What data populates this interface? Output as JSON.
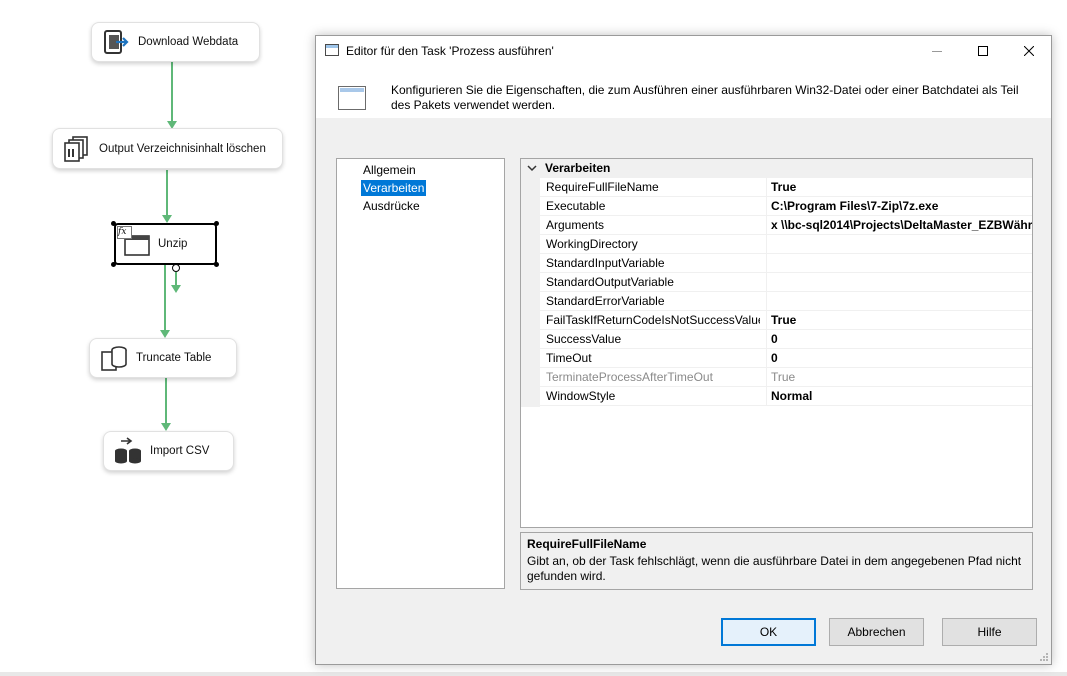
{
  "canvas": {
    "tasks": [
      {
        "label": "Download Webdata",
        "icon": "download-icon"
      },
      {
        "label": "Output Verzeichnisinhalt löschen",
        "icon": "file-system-icon"
      },
      {
        "label": "Unzip",
        "icon": "execute-process-icon"
      },
      {
        "label": "Truncate Table",
        "icon": "sql-task-icon"
      },
      {
        "label": "Import CSV",
        "icon": "data-flow-icon"
      }
    ],
    "colors": {
      "connector": "#5fb878"
    }
  },
  "dialog": {
    "title": "Editor für den Task 'Prozess ausführen'",
    "description": "Konfigurieren Sie die Eigenschaften, die zum Ausführen einer ausführbaren Win32-Datei oder einer Batchdatei als Teil des Pakets verwendet werden.",
    "nav": [
      {
        "label": "Allgemein"
      },
      {
        "label": "Verarbeiten",
        "selected": true
      },
      {
        "label": "Ausdrücke"
      }
    ],
    "grid": {
      "category": "Verarbeiten",
      "rows": [
        {
          "name": "RequireFullFileName",
          "value": "True"
        },
        {
          "name": "Executable",
          "value": "C:\\Program Files\\7-Zip\\7z.exe"
        },
        {
          "name": "Arguments",
          "value": " x \\\\bc-sql2014\\Projects\\DeltaMaster_EZBWähr"
        },
        {
          "name": "WorkingDirectory",
          "value": ""
        },
        {
          "name": "StandardInputVariable",
          "value": ""
        },
        {
          "name": "StandardOutputVariable",
          "value": ""
        },
        {
          "name": "StandardErrorVariable",
          "value": ""
        },
        {
          "name": "FailTaskIfReturnCodeIsNotSuccessValue",
          "value": "True"
        },
        {
          "name": "SuccessValue",
          "value": "0"
        },
        {
          "name": "TimeOut",
          "value": "0"
        },
        {
          "name": "TerminateProcessAfterTimeOut",
          "value": "True",
          "disabled": true
        },
        {
          "name": "WindowStyle",
          "value": "Normal"
        }
      ]
    },
    "help": {
      "title": "RequireFullFileName",
      "text": "Gibt an, ob der Task fehlschlägt, wenn die ausführbare Datei in dem angegebenen Pfad nicht gefunden wird."
    },
    "buttons": {
      "ok": "OK",
      "cancel": "Abbrechen",
      "help": "Hilfe"
    },
    "colors": {
      "selection": "#0078d7"
    }
  }
}
